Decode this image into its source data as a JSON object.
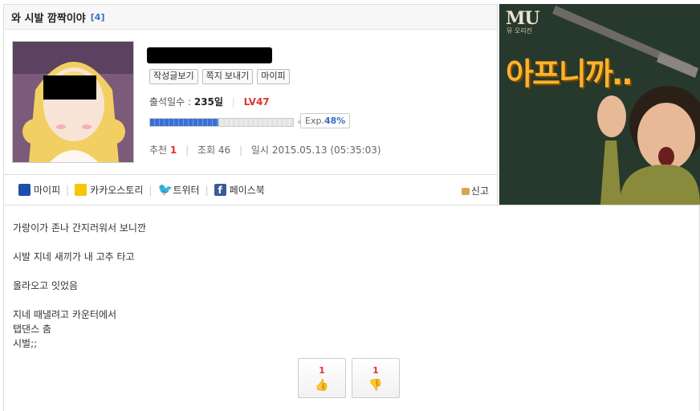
{
  "post": {
    "title": "와 시발 깜짝이야",
    "comment_count": "[4]"
  },
  "profile": {
    "buttons": [
      "작성글보기",
      "쪽지 보내기",
      "마이피"
    ],
    "attend_label": "출석일수 :",
    "attend_value": "235일",
    "level": "LV47",
    "exp_label": "Exp.",
    "exp_value": "48%",
    "exp_percent": 48
  },
  "meta": {
    "rec_label": "추천",
    "rec_value": "1",
    "view_label": "조회",
    "view_value": "46",
    "date_label": "일시",
    "date_value": "2015.05.13 (05:35:03)"
  },
  "share": {
    "mypi": "마이피",
    "kakao": "카카오스토리",
    "twitter": "트위터",
    "facebook": "페이스북",
    "report": "신고"
  },
  "ad": {
    "logo": "MU",
    "logo_sub": "뮤 오리진",
    "headline": "아프니까.."
  },
  "body_lines": [
    "가랑이가 존나 간지러워서 보니깐",
    "시발 지네 새끼가 내 고추 타고",
    "올라오고 잇었음",
    "지네 때낼려고 카운터에서",
    "탭댄스 춤",
    "시벌;;"
  ],
  "votes": {
    "up_count": "1",
    "down_count": "1"
  }
}
